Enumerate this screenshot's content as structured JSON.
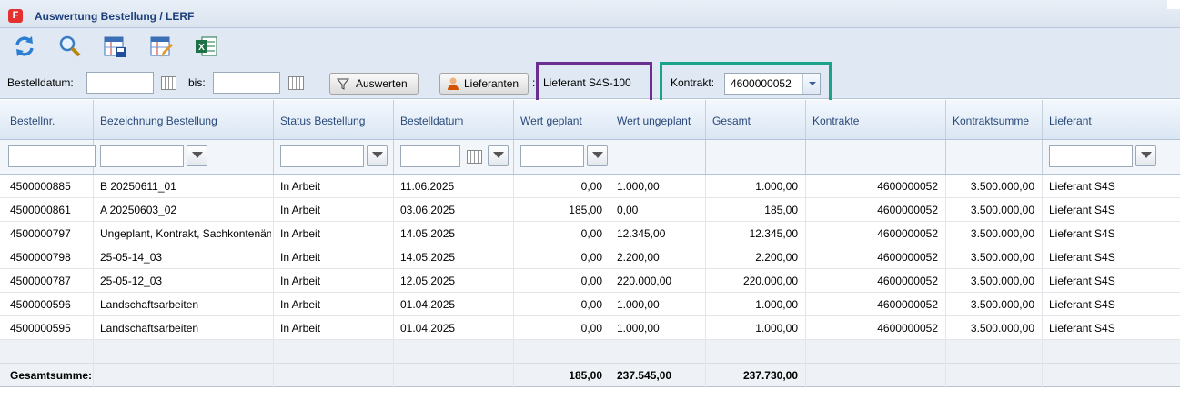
{
  "window": {
    "title": "Auswertung Bestellung / LERF",
    "app_icon": "F"
  },
  "toolbar": {
    "icons": [
      "refresh-icon",
      "search-icon",
      "save-layout-icon",
      "edit-layout-icon",
      "excel-export-icon"
    ]
  },
  "filters": {
    "bestelldatum_label": "Bestelldatum:",
    "bestelldatum_value": "",
    "bis_label": "bis:",
    "bis_value": "",
    "auswerten_label": "Auswerten",
    "lieferanten_label": "Lieferanten",
    "colon": ":",
    "lieferant_value": "Lieferant S4S-100",
    "kontrakt_label": "Kontrakt:",
    "kontrakt_value": "4600000052"
  },
  "highlight_colors": {
    "purple": "#6a2f8f",
    "green": "#1aa38a"
  },
  "table": {
    "headers": [
      "Bestellnr.",
      "Bezeichnung Bestellung",
      "Status Bestellung",
      "Bestelldatum",
      "Wert geplant",
      "Wert ungeplant",
      "Gesamt",
      "Kontrakte",
      "Kontraktsumme",
      "Lieferant"
    ],
    "rows": [
      [
        "4500000885",
        "B 20250611_01",
        "In Arbeit",
        "11.06.2025",
        "0,00",
        "1.000,00",
        "1.000,00",
        "4600000052",
        "3.500.000,00",
        "Lieferant S4S"
      ],
      [
        "4500000861",
        "A 20250603_02",
        "In Arbeit",
        "03.06.2025",
        "185,00",
        "0,00",
        "185,00",
        "4600000052",
        "3.500.000,00",
        "Lieferant S4S"
      ],
      [
        "4500000797",
        "Ungeplant, Kontrakt, Sachkontenänd",
        "In Arbeit",
        "14.05.2025",
        "0,00",
        "12.345,00",
        "12.345,00",
        "4600000052",
        "3.500.000,00",
        "Lieferant S4S"
      ],
      [
        "4500000798",
        "25-05-14_03",
        "In Arbeit",
        "14.05.2025",
        "0,00",
        "2.200,00",
        "2.200,00",
        "4600000052",
        "3.500.000,00",
        "Lieferant S4S"
      ],
      [
        "4500000787",
        "25-05-12_03",
        "In Arbeit",
        "12.05.2025",
        "0,00",
        "220.000,00",
        "220.000,00",
        "4600000052",
        "3.500.000,00",
        "Lieferant S4S"
      ],
      [
        "4500000596",
        "Landschaftsarbeiten",
        "In Arbeit",
        "01.04.2025",
        "0,00",
        "1.000,00",
        "1.000,00",
        "4600000052",
        "3.500.000,00",
        "Lieferant S4S"
      ],
      [
        "4500000595",
        "Landschaftsarbeiten",
        "In Arbeit",
        "01.04.2025",
        "0,00",
        "1.000,00",
        "1.000,00",
        "4600000052",
        "3.500.000,00",
        "Lieferant S4S"
      ]
    ],
    "summary": {
      "label": "Gesamtsumme:",
      "wert_geplant": "185,00",
      "wert_ungeplant": "237.545,00",
      "gesamt": "237.730,00"
    }
  }
}
